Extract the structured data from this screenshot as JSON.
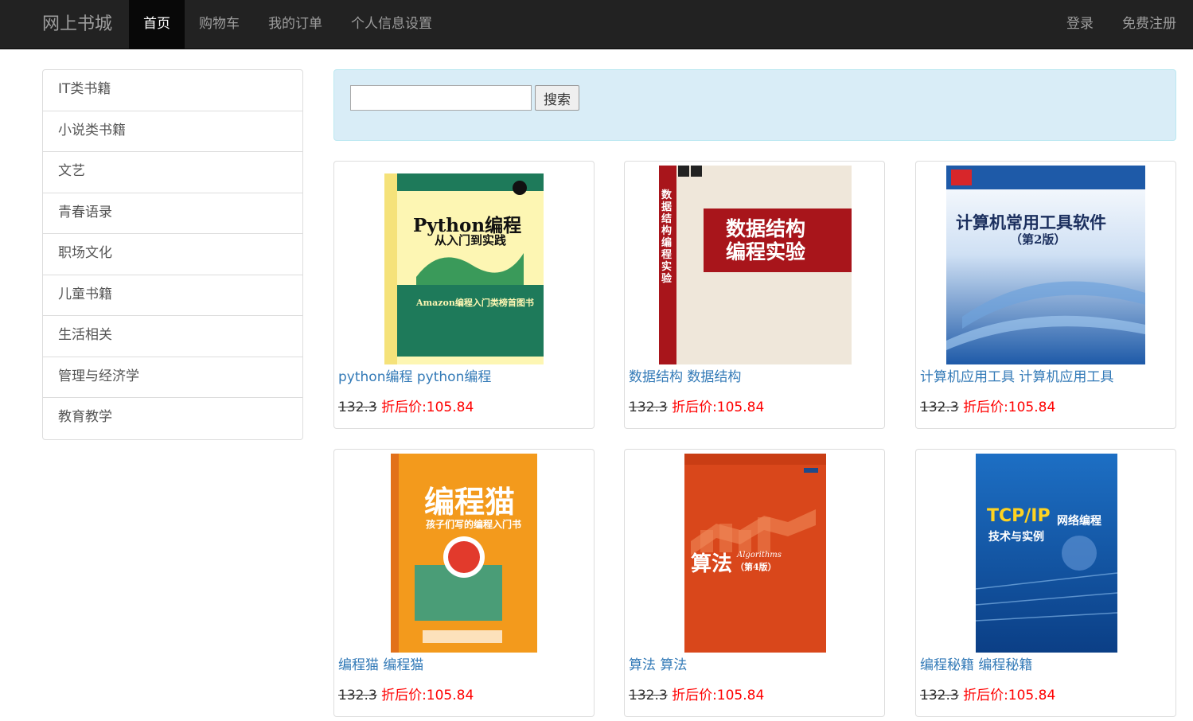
{
  "nav": {
    "brand": "网上书城",
    "links": [
      "首页",
      "购物车",
      "我的订单",
      "个人信息设置"
    ],
    "right_links": [
      "登录",
      "免费注册"
    ]
  },
  "sidebar": {
    "items": [
      "IT类书籍",
      "小说类书籍",
      "文艺",
      "青春语录",
      "职场文化",
      "儿童书籍",
      "生活相关",
      "管理与经济学",
      "教育教学"
    ]
  },
  "search": {
    "value": "",
    "button_label": "搜索"
  },
  "products": [
    {
      "title": "python编程 python编程",
      "original_price": "132.3",
      "discount_label": "折后价:105.84",
      "cover": {
        "line1": "Python编程",
        "line2": "从入门到实践",
        "tag": "Amazon编程入门类榜首图书"
      }
    },
    {
      "title": "数据结构 数据结构",
      "original_price": "132.3",
      "discount_label": "折后价:105.84",
      "cover": {
        "line1": "数据结构",
        "line2": "编程实验",
        "spine": "数据结构编程实验"
      }
    },
    {
      "title": "计算机应用工具 计算机应用工具",
      "original_price": "132.3",
      "discount_label": "折后价:105.84",
      "cover": {
        "line1": "计算机常用工具软件",
        "line2": "（第2版）"
      }
    },
    {
      "title": "编程猫 编程猫",
      "original_price": "132.3",
      "discount_label": "折后价:105.84",
      "cover": {
        "line1": "编程猫",
        "line2": "孩子们写的编程入门书"
      }
    },
    {
      "title": "算法 算法",
      "original_price": "132.3",
      "discount_label": "折后价:105.84",
      "cover": {
        "line1": "算法",
        "line2": "Algorithms",
        "line3": "（第4版）"
      }
    },
    {
      "title": "编程秘籍 编程秘籍",
      "original_price": "132.3",
      "discount_label": "折后价:105.84",
      "cover": {
        "line1": "TCP/IP",
        "line2": "网络编程",
        "line3": "技术与实例"
      }
    }
  ]
}
